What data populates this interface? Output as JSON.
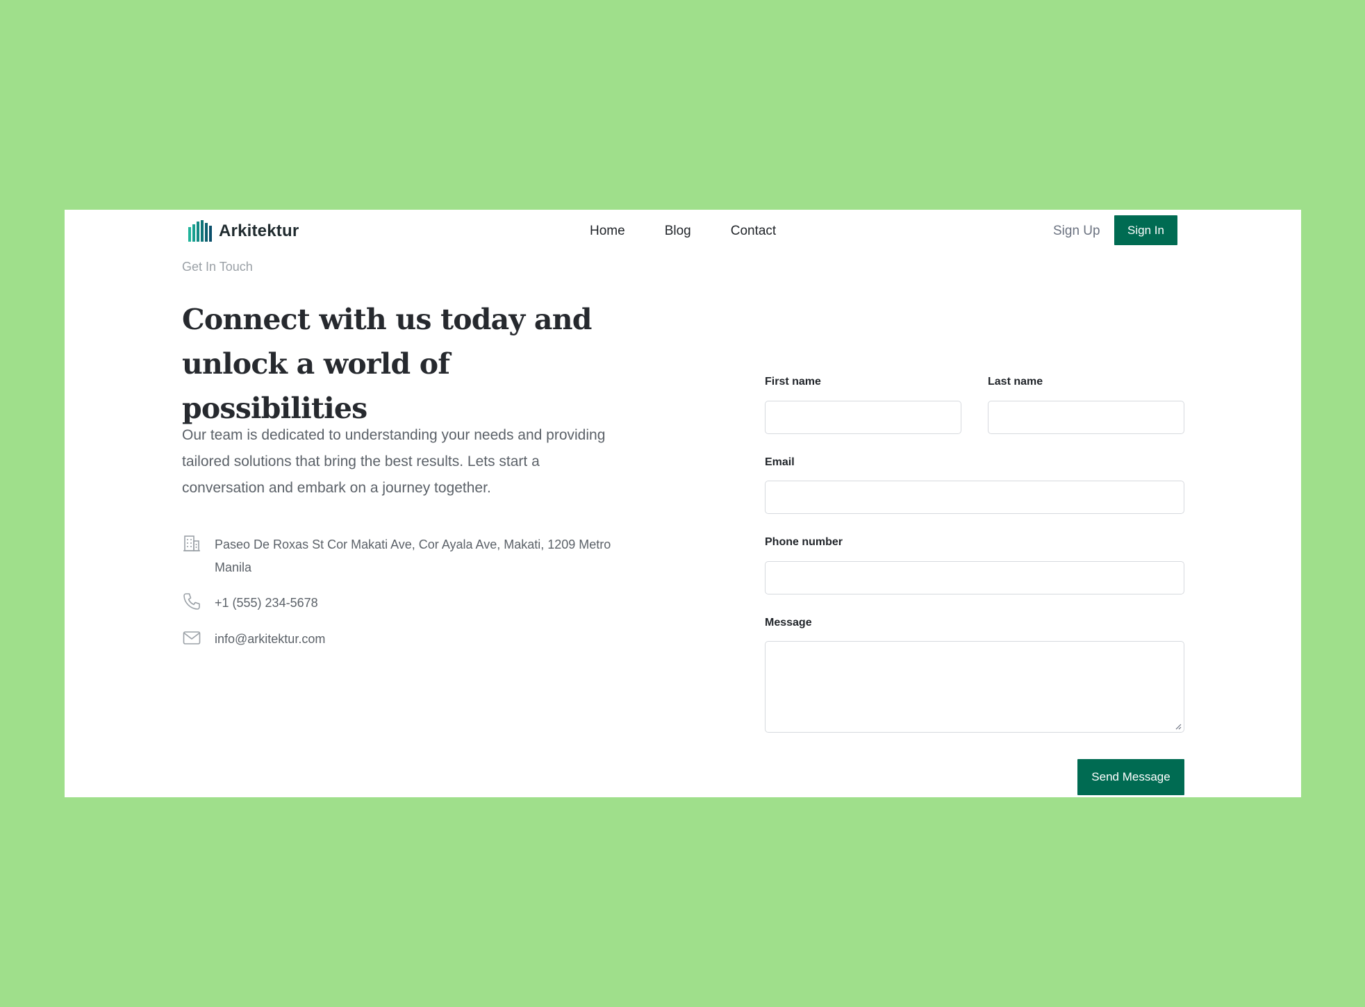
{
  "brand": {
    "name": "Arkitektur",
    "logo_icon": "building-columns-logo"
  },
  "nav": {
    "items": [
      {
        "label": "Home"
      },
      {
        "label": "Blog"
      },
      {
        "label": "Contact"
      }
    ],
    "sign_up_label": "Sign Up",
    "sign_in_label": "Sign In"
  },
  "hero": {
    "eyebrow": "Get In Touch",
    "headline": "Connect with us today and unlock a world of possibilities",
    "description": "Our team is dedicated to understanding your needs and providing tailored solutions that bring the best results. Lets start a conversation and embark on a journey together."
  },
  "contact": {
    "address": "Paseo De Roxas St Cor Makati Ave, Cor Ayala Ave, Makati, 1209 Metro Manila",
    "phone": "+1 (555) 234-5678",
    "email": "info@arkitektur.com",
    "icons": [
      "building-icon",
      "phone-icon",
      "mail-icon"
    ]
  },
  "form": {
    "first_name_label": "First name",
    "first_name_value": "",
    "last_name_label": "Last name",
    "last_name_value": "",
    "email_label": "Email",
    "email_value": "",
    "phone_label": "Phone number",
    "phone_value": "",
    "message_label": "Message",
    "message_value": "",
    "submit_label": "Send Message"
  },
  "colors": {
    "background": "#9fdf8b",
    "accent": "#006b52",
    "text_dark": "#1f2328",
    "text_muted": "#5b6168"
  }
}
